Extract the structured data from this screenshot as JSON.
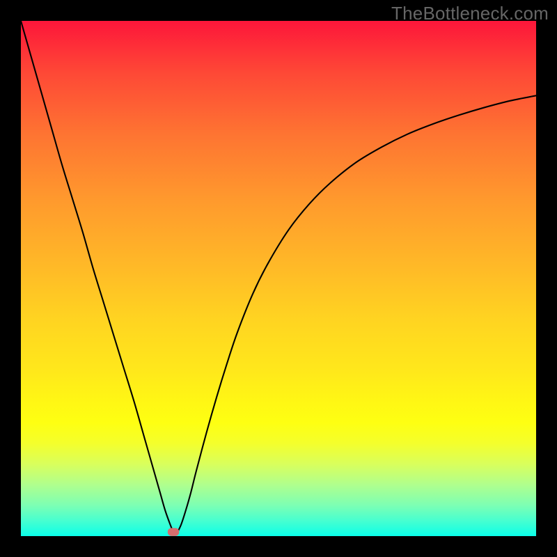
{
  "watermark": "TheBottleneck.com",
  "chart_data": {
    "type": "line",
    "title": "",
    "xlabel": "",
    "ylabel": "",
    "x_range": [
      0,
      100
    ],
    "y_range": [
      0,
      100
    ],
    "legend": false,
    "grid": false,
    "background": "rainbow-gradient-vertical",
    "series": [
      {
        "name": "bottleneck-curve",
        "color": "#000000",
        "x": [
          0,
          2,
          4,
          6,
          8,
          10,
          12,
          14,
          16,
          18,
          20,
          22,
          24,
          26,
          27,
          28,
          29,
          29.6,
          30,
          31,
          32,
          33,
          34,
          36,
          38,
          40,
          42,
          45,
          48,
          52,
          56,
          60,
          65,
          70,
          75,
          80,
          85,
          90,
          95,
          100
        ],
        "y": [
          100,
          93,
          86,
          79,
          72,
          65.5,
          59,
          52,
          45.5,
          39,
          32.5,
          26,
          19,
          12,
          8.5,
          5,
          2.2,
          0.8,
          0.3,
          2,
          5,
          8.5,
          12.5,
          20,
          27,
          33.5,
          39.5,
          47,
          53,
          59.5,
          64.5,
          68.5,
          72.5,
          75.5,
          78,
          80,
          81.7,
          83.2,
          84.5,
          85.5
        ]
      }
    ],
    "marker": {
      "name": "current-point",
      "x": 29.6,
      "y": 0.8,
      "color": "#d66e6f",
      "shape": "rounded-rect"
    }
  }
}
